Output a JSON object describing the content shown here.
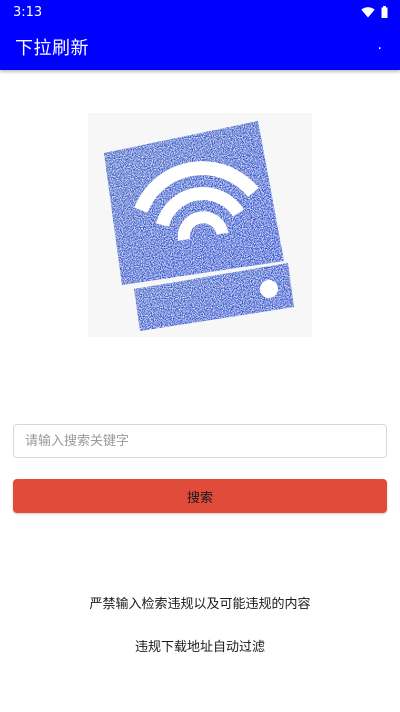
{
  "status_bar": {
    "time": "3:13",
    "icons": [
      "wifi-icon",
      "battery-icon"
    ]
  },
  "app_bar": {
    "title": "下拉刷新",
    "overflow_label": "."
  },
  "logo": {
    "icon": "wifi-device-logo",
    "colors": {
      "primary": "#2a5bd7",
      "background": "#f7f7f7"
    }
  },
  "search": {
    "placeholder": "请输入搜索关键字",
    "value": "",
    "button_label": "搜索"
  },
  "notices": {
    "line1": "严禁输入检索违规以及可能违规的内容",
    "line2": "违规下载地址自动过滤"
  },
  "colors": {
    "app_bar": "#0000ff",
    "button": "#e04b3a"
  }
}
